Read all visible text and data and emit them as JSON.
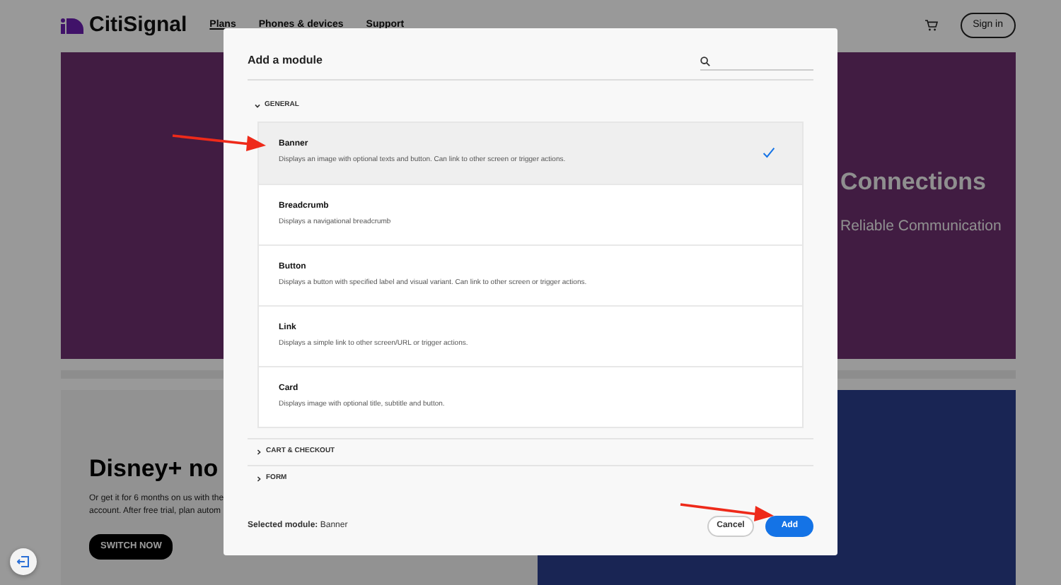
{
  "site": {
    "logo": "CitiSignal",
    "nav": [
      "Plans",
      "Phones & devices",
      "Support"
    ],
    "sign_in": "Sign in",
    "hero": {
      "title": "Connections",
      "subtitle": "Reliable Communication"
    },
    "promo": {
      "title": "Disney+ no",
      "text_lines": [
        "Or get it for 6 months on us with the",
        "account. After free trial, plan autom"
      ],
      "button": "SWITCH NOW"
    }
  },
  "modal": {
    "title": "Add a module",
    "sections": [
      {
        "label": "GENERAL",
        "expanded": true,
        "items": [
          {
            "title": "Banner",
            "description": "Displays an image with optional texts and button. Can link to other screen or trigger actions.",
            "selected": true
          },
          {
            "title": "Breadcrumb",
            "description": "Displays a navigational breadcrumb",
            "selected": false
          },
          {
            "title": "Button",
            "description": "Displays a button with specified label and visual variant. Can link to other screen or trigger actions.",
            "selected": false
          },
          {
            "title": "Link",
            "description": "Displays a simple link to other screen/URL or trigger actions.",
            "selected": false
          },
          {
            "title": "Card",
            "description": "Displays image with optional title, subtitle and button.",
            "selected": false
          }
        ]
      },
      {
        "label": "CART & CHECKOUT",
        "expanded": false
      },
      {
        "label": "FORM",
        "expanded": false
      }
    ],
    "selected_module": "**Selected module:** Banner",
    "buttons": [
      {
        "label": "Cancel",
        "kind": "secondary"
      },
      {
        "label": "Add",
        "kind": "primary"
      }
    ]
  }
}
